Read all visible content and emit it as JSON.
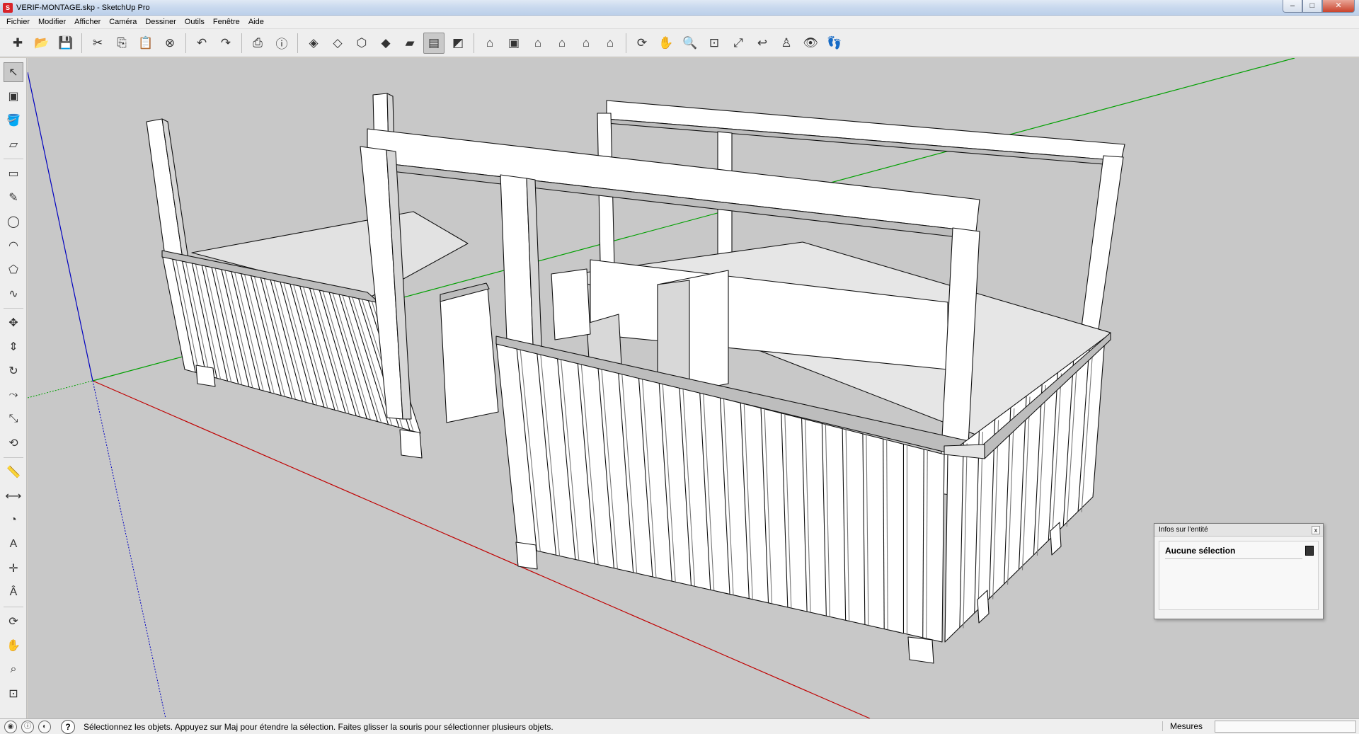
{
  "window": {
    "title": "VERIF-MONTAGE.skp - SketchUp Pro",
    "controls": [
      "–",
      "□",
      "✕"
    ]
  },
  "menu": [
    "Fichier",
    "Modifier",
    "Afficher",
    "Caméra",
    "Dessiner",
    "Outils",
    "Fenêtre",
    "Aide"
  ],
  "toolbar_groups": [
    [
      "new-model-icon",
      "open-folder-icon",
      "save-icon"
    ],
    [
      "cut-icon",
      "copy-icon",
      "paste-icon",
      "erase-icon"
    ],
    [
      "undo-icon",
      "redo-icon"
    ],
    [
      "print-icon",
      "model-info-icon"
    ],
    [
      "xray-icon",
      "wireframe-icon",
      "hidden-line-icon",
      "shaded-icon",
      "shaded-textures-icon",
      "monochrome-icon",
      "back-edges-icon"
    ],
    [
      "iso-view-icon",
      "top-view-icon",
      "front-view-icon",
      "right-view-icon",
      "back-view-icon",
      "left-view-icon"
    ],
    [
      "orbit-icon",
      "pan-icon",
      "zoom-icon",
      "zoom-window-icon",
      "zoom-extents-icon",
      "previous-view-icon",
      "position-camera-icon",
      "look-around-icon",
      "walk-icon"
    ]
  ],
  "toolbar_glyphs": {
    "new-model-icon": "✚",
    "open-folder-icon": "📂",
    "save-icon": "💾",
    "cut-icon": "✂",
    "copy-icon": "⎘",
    "paste-icon": "📋",
    "erase-icon": "⊗",
    "undo-icon": "↶",
    "redo-icon": "↷",
    "print-icon": "⎙",
    "model-info-icon": "ⓘ",
    "xray-icon": "◈",
    "wireframe-icon": "◇",
    "hidden-line-icon": "⬡",
    "shaded-icon": "◆",
    "shaded-textures-icon": "▰",
    "monochrome-icon": "▤",
    "back-edges-icon": "◩",
    "iso-view-icon": "⌂",
    "top-view-icon": "▣",
    "front-view-icon": "⌂",
    "right-view-icon": "⌂",
    "back-view-icon": "⌂",
    "left-view-icon": "⌂",
    "orbit-icon": "⟳",
    "pan-icon": "✋",
    "zoom-icon": "🔍",
    "zoom-window-icon": "⊡",
    "zoom-extents-icon": "⤢",
    "previous-view-icon": "↩",
    "position-camera-icon": "♙",
    "look-around-icon": "👁",
    "walk-icon": "👣"
  },
  "active_toolbar_tool": "monochrome-icon",
  "palette": [
    [
      "select-icon",
      "↖"
    ],
    [
      "make-component-icon",
      "▣"
    ],
    [
      "paint-bucket-icon",
      "🪣"
    ],
    [
      "eraser-icon",
      "▱"
    ],
    null,
    [
      "rectangle-icon",
      "▭"
    ],
    [
      "line-icon",
      "✎"
    ],
    [
      "circle-icon",
      "◯"
    ],
    [
      "arc-icon",
      "◠"
    ],
    [
      "polygon-icon",
      "⬠"
    ],
    [
      "freehand-icon",
      "∿"
    ],
    null,
    [
      "move-icon",
      "✥"
    ],
    [
      "push-pull-icon",
      "⇕"
    ],
    [
      "rotate-icon",
      "↻"
    ],
    [
      "follow-me-icon",
      "⤳"
    ],
    [
      "scale-icon",
      "⤡"
    ],
    [
      "offset-icon",
      "⟲"
    ],
    null,
    [
      "tape-measure-icon",
      "📏"
    ],
    [
      "dimension-icon",
      "⟷"
    ],
    [
      "protractor-icon",
      "◔"
    ],
    [
      "text-icon",
      "A"
    ],
    [
      "axes-icon",
      "✛"
    ],
    [
      "3d-text-icon",
      "Â"
    ],
    null,
    [
      "orbit-tool-icon",
      "⟳"
    ],
    [
      "pan-tool-icon",
      "✋"
    ],
    [
      "zoom-tool-icon",
      "⌕"
    ],
    [
      "zoom-extents-tool-icon",
      "⊡"
    ]
  ],
  "entity_info": {
    "title": "Infos sur l'entité",
    "close": "x",
    "selection": "Aucune sélection"
  },
  "status": {
    "message": "Sélectionnez les objets. Appuyez sur Maj pour étendre la sélection. Faites glisser la souris pour sélectionner plusieurs objets.",
    "help": "?",
    "measurements_label": "Mesures"
  },
  "colors": {
    "x_axis": "#c00000",
    "y_axis": "#00a000",
    "z_axis": "#0000c0",
    "background": "#c8c8c8",
    "face": "#ffffff",
    "face_shade": "#d6d6d6"
  }
}
